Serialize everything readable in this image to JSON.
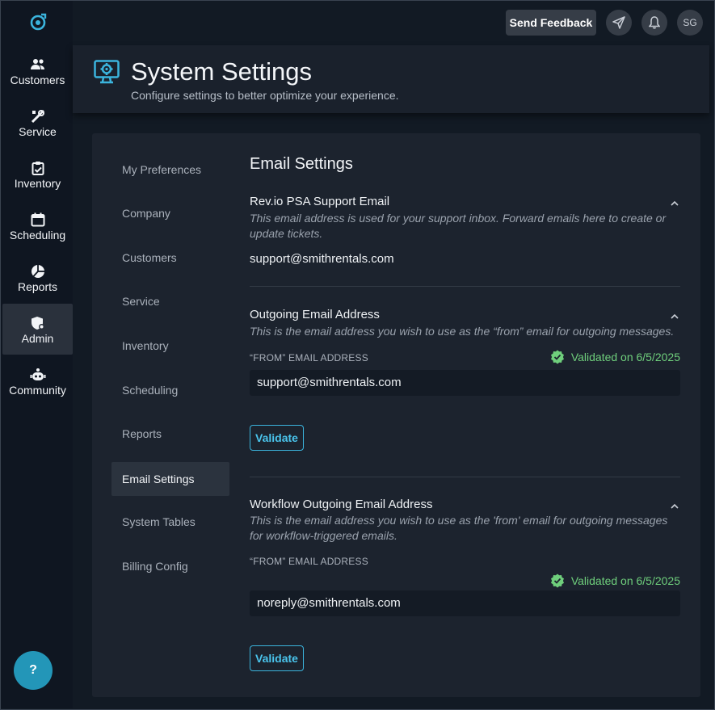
{
  "nav": {
    "items": [
      {
        "label": "Customers"
      },
      {
        "label": "Service"
      },
      {
        "label": "Inventory"
      },
      {
        "label": "Scheduling"
      },
      {
        "label": "Reports"
      },
      {
        "label": "Admin"
      },
      {
        "label": "Community"
      }
    ],
    "help_label": "?"
  },
  "topbar": {
    "feedback_label": "Send Feedback",
    "user_initials": "SG"
  },
  "header": {
    "title": "System Settings",
    "subtitle": "Configure settings to better optimize your experience."
  },
  "subnav": {
    "items": [
      {
        "label": "My Preferences"
      },
      {
        "label": "Company"
      },
      {
        "label": "Customers"
      },
      {
        "label": "Service"
      },
      {
        "label": "Inventory"
      },
      {
        "label": "Scheduling"
      },
      {
        "label": "Reports"
      },
      {
        "label": "Email Settings"
      },
      {
        "label": "System Tables"
      },
      {
        "label": "Billing Config"
      }
    ],
    "active": "Email Settings"
  },
  "email": {
    "section_title": "Email Settings",
    "support": {
      "title": "Rev.io PSA Support Email",
      "description": "This email address is used for your support inbox. Forward emails here to create or update tickets.",
      "value": "support@smithrentals.com"
    },
    "outgoing": {
      "title": "Outgoing Email Address",
      "description": "This is the email address you wish to use as the “from” email for outgoing messages.",
      "field_label": "“FROM” EMAIL ADDRESS",
      "validated_text": "Validated on 6/5/2025",
      "value": "support@smithrentals.com",
      "validate_label": "Validate"
    },
    "workflow": {
      "title": "Workflow Outgoing Email Address",
      "description": "This is the email address you wish to use as the 'from' email for outgoing messages for workflow-triggered emails.",
      "field_label": "“FROM” EMAIL ADDRESS",
      "validated_text": "Validated on 6/5/2025",
      "value": "noreply@smithrentals.com",
      "validate_label": "Validate"
    }
  },
  "icons": {
    "logo": "app-logo-icon",
    "accent": "#3bb4dd",
    "success": "#6fcf7c"
  }
}
